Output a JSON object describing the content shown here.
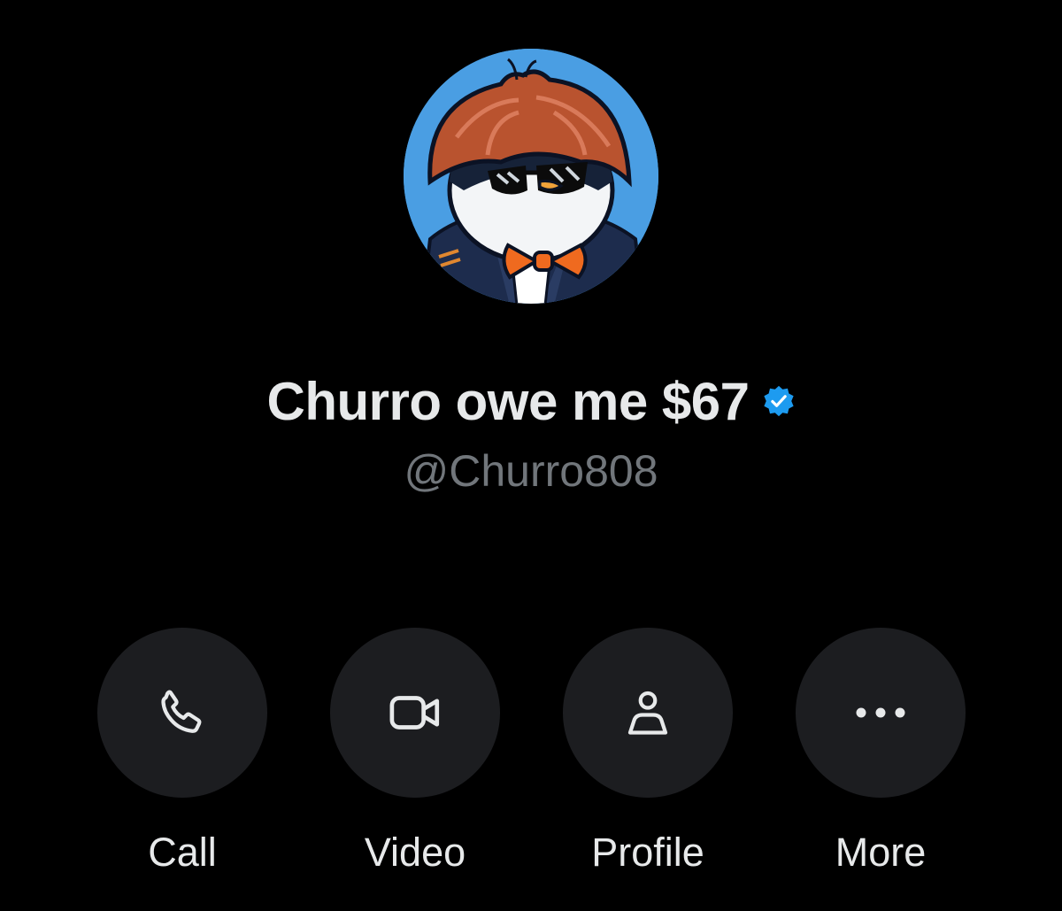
{
  "profile": {
    "display_name": "Churro owe me $67",
    "handle": "@Churro808",
    "verified_icon": "verified-badge-icon",
    "avatar_description_icon": "penguin-avatar"
  },
  "actions": [
    {
      "label": "Call",
      "icon": "phone-icon"
    },
    {
      "label": "Video",
      "icon": "video-camera-icon"
    },
    {
      "label": "Profile",
      "icon": "person-icon"
    },
    {
      "label": "More",
      "icon": "more-dots-icon"
    }
  ],
  "colors": {
    "background": "#000000",
    "text_primary": "#e7e9ea",
    "text_secondary": "#71767b",
    "button_bg": "#1c1d20",
    "verified_blue": "#1d9bf0",
    "avatar_bg": "#4a9ee3"
  }
}
